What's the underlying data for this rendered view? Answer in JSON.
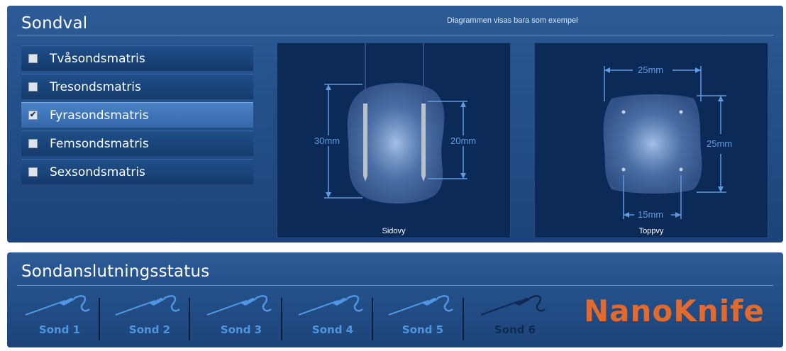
{
  "probe_select": {
    "title": "Sondval",
    "note": "Diagrammen visas bara som exempel",
    "options": [
      {
        "label": "Tvåsondsmatris",
        "checked": false
      },
      {
        "label": "Tresondsmatris",
        "checked": false
      },
      {
        "label": "Fyrasondsmatris",
        "checked": true
      },
      {
        "label": "Femsondsmatris",
        "checked": false
      },
      {
        "label": "Sexsondsmatris",
        "checked": false
      }
    ],
    "check_glyph": "✔",
    "side_view": {
      "caption": "Sidovy",
      "height_label": "30mm",
      "active_label": "20mm"
    },
    "top_view": {
      "caption": "Toppvy",
      "width_label": "25mm",
      "depth_label": "25mm",
      "spacing_label": "15mm"
    }
  },
  "probe_status": {
    "title": "Sondanslutningsstatus",
    "probes": [
      {
        "label": "Sond 1",
        "connected": true
      },
      {
        "label": "Sond 2",
        "connected": true
      },
      {
        "label": "Sond 3",
        "connected": true
      },
      {
        "label": "Sond 4",
        "connected": true
      },
      {
        "label": "Sond 5",
        "connected": true
      },
      {
        "label": "Sond 6",
        "connected": false
      }
    ],
    "brand": "NanoKnife"
  },
  "colors": {
    "panel": "#24508a",
    "selected_option": "#3f76b8",
    "diagram_bg": "#0c2a57",
    "dimension": "#5e9ae0",
    "probe_connected": "#4f95e2",
    "probe_disconnected": "#0f2a50",
    "brand": "#e36a2e"
  },
  "icons": {
    "probe": "probe-icon"
  }
}
